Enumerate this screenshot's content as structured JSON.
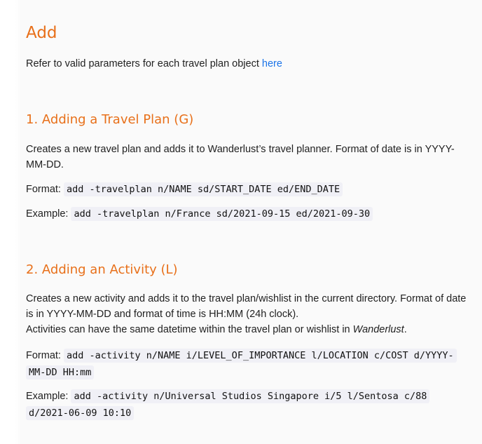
{
  "title": "Add",
  "intro": {
    "text": "Refer to valid parameters for each travel plan object ",
    "link_label": "here"
  },
  "sections": [
    {
      "heading": "1. Adding a Travel Plan (G)",
      "description": "Creates a new travel plan and adds it to Wanderlust’s travel planner. Format of date is in YYYY-MM-DD.",
      "format_label": "Format:",
      "format_code": "add -travelplan n/NAME sd/START_DATE ed/END_DATE",
      "example_label": "Example:",
      "example_code": "add -travelplan n/France sd/2021-09-15 ed/2021-09-30"
    },
    {
      "heading": "2. Adding an Activity (L)",
      "description": "Creates a new activity and adds it to the travel plan/wishlist in the current directory. Format of date is in YYYY-MM-DD and format of time is HH:MM (24h clock).",
      "note_prefix": "Activities can have the same datetime within the travel plan or wishlist in ",
      "note_emphasis": "Wanderlust",
      "note_suffix": ".",
      "format_label": "Format:",
      "format_code": "add -activity n/NAME i/LEVEL_OF_IMPORTANCE l/LOCATION c/COST d/YYYY-MM-DD HH:mm",
      "example_label": "Example:",
      "example_code": "add -activity n/Universal Studios Singapore i/5 l/Sentosa c/88 d/2021-06-09 10:10"
    }
  ]
}
